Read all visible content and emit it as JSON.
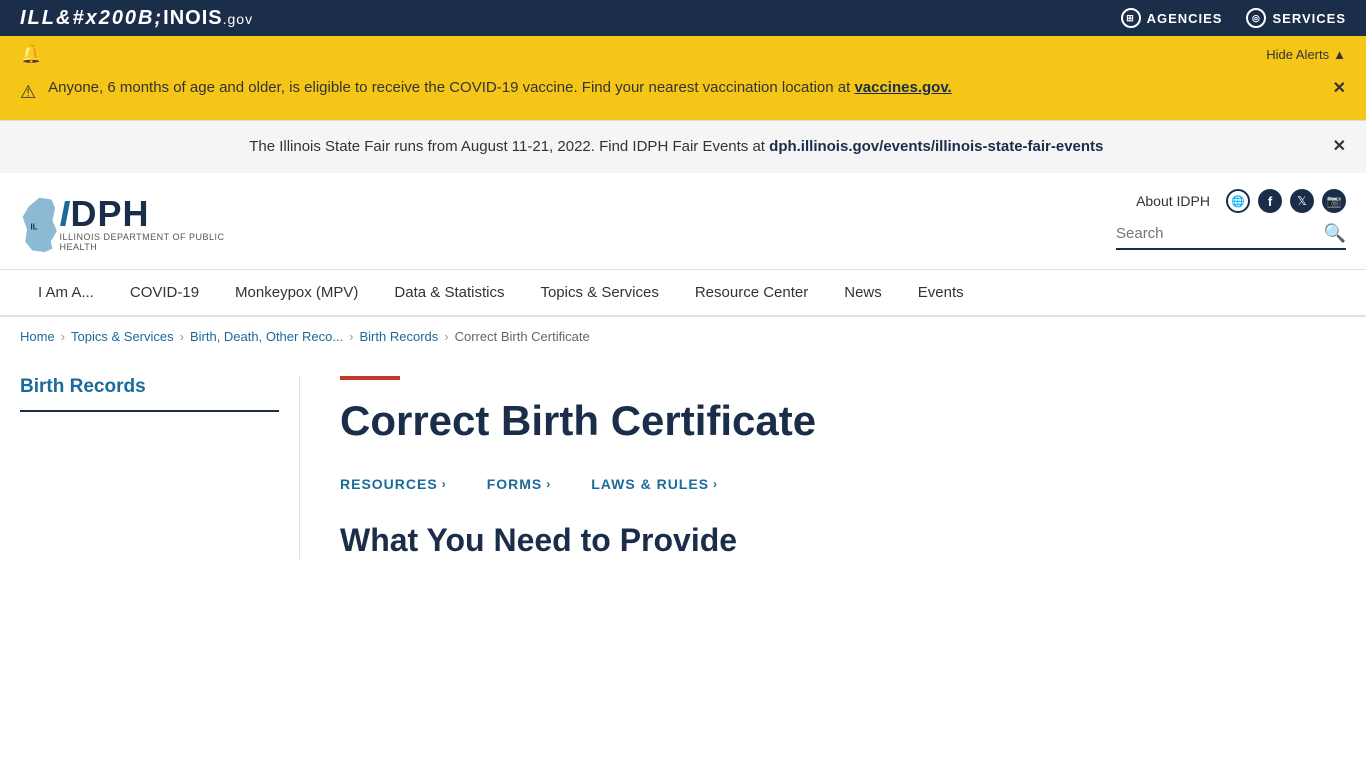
{
  "govBar": {
    "logo": "ILL",
    "logoItalic": "ILL",
    "logoRest": "INOIS",
    "dotGov": ".gov",
    "links": [
      {
        "label": "AGENCIES",
        "icon": "grid"
      },
      {
        "label": "SERVICES",
        "icon": "circles"
      }
    ]
  },
  "alertBanner": {
    "bellIcon": "🔔",
    "hideAlertsLabel": "Hide Alerts",
    "hideAlertsIcon": "▲",
    "message": "Anyone, 6 months of age and older, is eligible to receive the COVID-19 vaccine. Find your nearest vaccination location at",
    "linkText": "vaccines.gov.",
    "linkUrl": "https://vaccines.gov",
    "closeIcon": "✕"
  },
  "infoBanner": {
    "message": "The Illinois State Fair runs from August 11-21, 2022. Find IDPH Fair Events at",
    "linkText": "dph.illinois.gov/events/illinois-state-fair-events",
    "linkUrl": "#",
    "closeIcon": "✕"
  },
  "header": {
    "logoSubtitle": "Illinois Department of Public Health",
    "aboutLink": "About IDPH",
    "searchPlaceholder": "Search",
    "socialLinks": [
      "globe",
      "facebook",
      "twitter",
      "instagram"
    ]
  },
  "nav": {
    "items": [
      {
        "label": "I Am A...",
        "url": "#"
      },
      {
        "label": "COVID-19",
        "url": "#"
      },
      {
        "label": "Monkeypox (MPV)",
        "url": "#"
      },
      {
        "label": "Data & Statistics",
        "url": "#"
      },
      {
        "label": "Topics & Services",
        "url": "#"
      },
      {
        "label": "Resource Center",
        "url": "#"
      },
      {
        "label": "News",
        "url": "#"
      },
      {
        "label": "Events",
        "url": "#"
      }
    ]
  },
  "breadcrumb": {
    "items": [
      {
        "label": "Home",
        "url": "#"
      },
      {
        "label": "Topics & Services",
        "url": "#"
      },
      {
        "label": "Birth, Death, Other Reco...",
        "url": "#"
      },
      {
        "label": "Birth Records",
        "url": "#"
      },
      {
        "label": "Correct Birth Certificate",
        "url": "#"
      }
    ]
  },
  "sidebar": {
    "title": "Birth Records"
  },
  "pageContent": {
    "accentLine": true,
    "title": "Correct Birth Certificate",
    "links": [
      {
        "label": "RESOURCES",
        "url": "#"
      },
      {
        "label": "FORMS",
        "url": "#"
      },
      {
        "label": "LAWS & RULES",
        "url": "#"
      }
    ],
    "sectionHeading": "What You Need to Provide"
  }
}
